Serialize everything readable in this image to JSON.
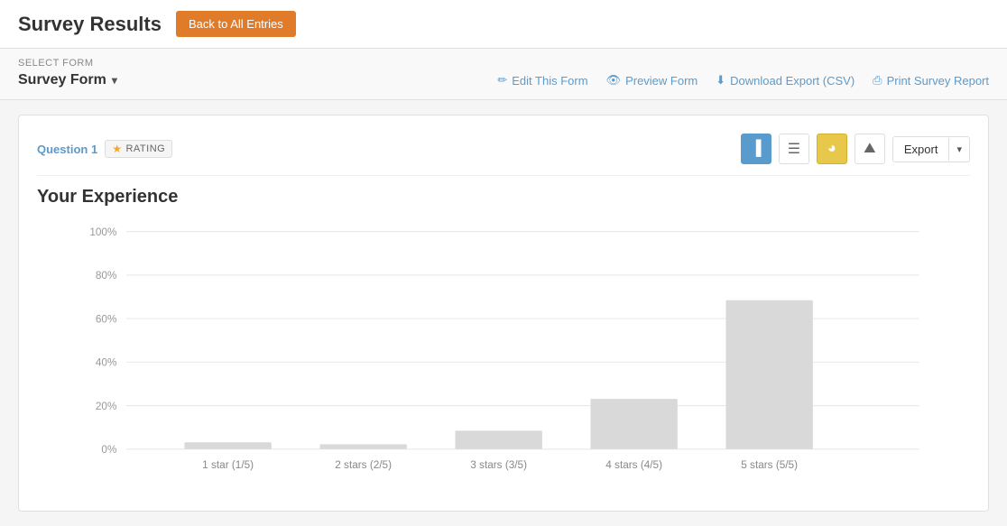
{
  "topBar": {
    "title": "Survey Results",
    "backButton": "Back to All Entries"
  },
  "formBar": {
    "selectFormLabel": "SELECT FORM",
    "selectedForm": "Survey Form",
    "actions": [
      {
        "id": "edit",
        "label": "Edit This Form",
        "icon": "✏️"
      },
      {
        "id": "preview",
        "label": "Preview Form",
        "icon": "👁"
      },
      {
        "id": "download",
        "label": "Download Export (CSV)",
        "icon": "⬇"
      },
      {
        "id": "print",
        "label": "Print Survey Report",
        "icon": "🖨"
      }
    ]
  },
  "question": {
    "number": "Question 1",
    "typeLabel": "RATING",
    "title": "Your Experience",
    "exportLabel": "Export"
  },
  "chart": {
    "yLabels": [
      "0%",
      "20%",
      "40%",
      "60%",
      "80%",
      "100%"
    ],
    "bars": [
      {
        "label": "1 star (1/5)",
        "value": 3
      },
      {
        "label": "2 stars (2/5)",
        "value": 2
      },
      {
        "label": "3 stars (3/5)",
        "value": 8
      },
      {
        "label": "4 stars (4/5)",
        "value": 22
      },
      {
        "label": "5 stars (5/5)",
        "value": 65
      }
    ]
  }
}
